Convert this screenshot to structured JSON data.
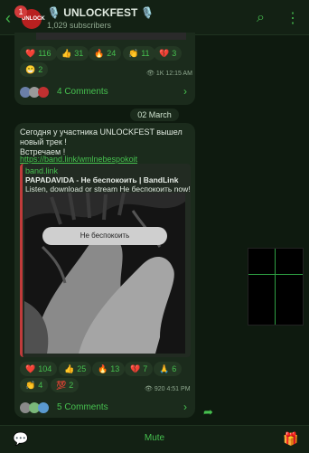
{
  "header": {
    "unread_count": "1",
    "avatar_text": "UNLOCK FEST",
    "title": "🎙️ UNLOCKFEST 🎙️",
    "subscribers": "1,029 subscribers",
    "back_glyph": "‹",
    "search_glyph": "⌕",
    "menu_glyph": "⋮"
  },
  "post1": {
    "reactions": [
      {
        "emoji": "❤️",
        "count": "116"
      },
      {
        "emoji": "👍",
        "count": "31"
      },
      {
        "emoji": "🔥",
        "count": "24"
      },
      {
        "emoji": "👏",
        "count": "11"
      },
      {
        "emoji": "💔",
        "count": "3"
      },
      {
        "emoji": "😁",
        "count": "2"
      }
    ],
    "views_time": "👁 1K 12:15 AM",
    "comments": "4 Comments",
    "chevron": "›"
  },
  "date_separator": "02 March",
  "post2": {
    "text_line1": "Сегодня  у  участника UNLOCKFEST вышел",
    "text_line2": "новый трек !",
    "text_line3": "Встречаем !",
    "link": "https://band.link/wmlnebespokoit",
    "preview": {
      "site": "band.link",
      "title": "PAPADAVIDA - Не беспокоить | BandLink",
      "description": "Listen, download or stream Не беспокоить now!",
      "button": "Не беспокоить"
    },
    "reactions": [
      {
        "emoji": "❤️",
        "count": "104"
      },
      {
        "emoji": "👍",
        "count": "25"
      },
      {
        "emoji": "🔥",
        "count": "13"
      },
      {
        "emoji": "💔",
        "count": "7"
      },
      {
        "emoji": "🙏",
        "count": "6"
      },
      {
        "emoji": "👏",
        "count": "4"
      },
      {
        "emoji": "💯",
        "count": "2"
      }
    ],
    "views_time": "👁 920 4:51 PM",
    "comments": "5 Comments",
    "chevron": "›",
    "share_glyph": "➦"
  },
  "bottom_bar": {
    "mute": "Mute",
    "chat_glyph": "💬",
    "gift_glyph": "🎁"
  },
  "colors": {
    "accent": "#46c04f",
    "background": "#0e1a0f",
    "bubble": "#1b2b1c"
  }
}
